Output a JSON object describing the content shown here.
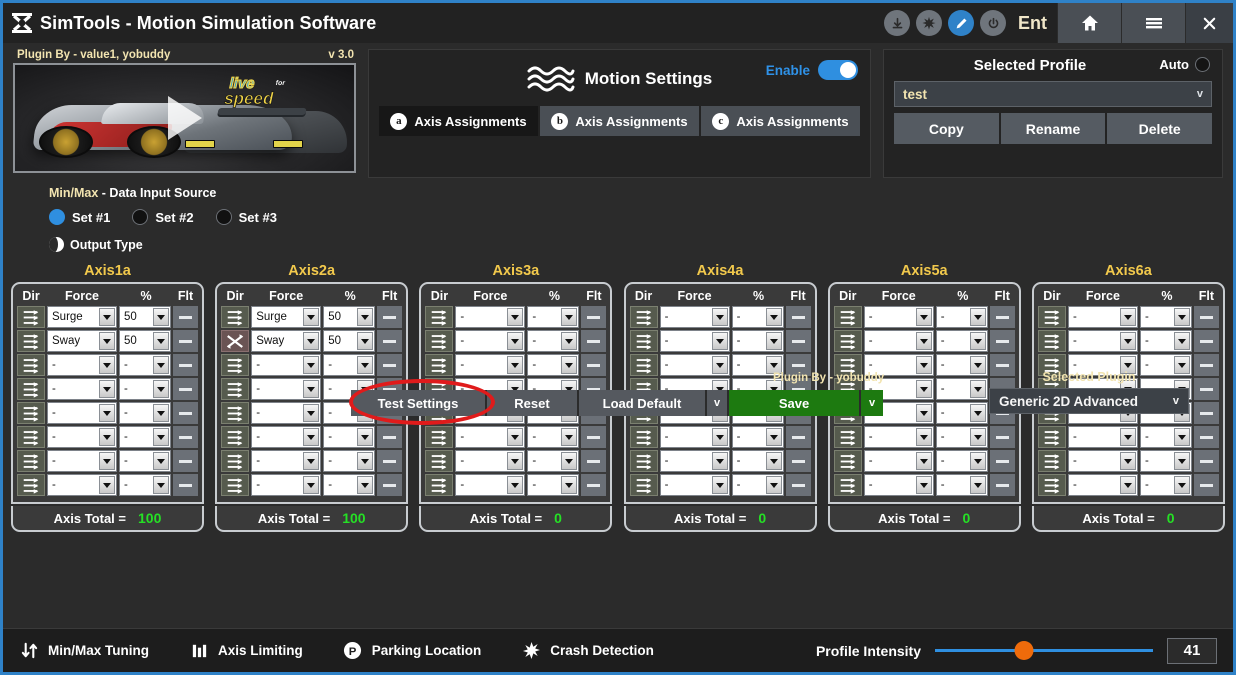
{
  "titlebar": {
    "app_name_prefix": "SimT",
    "app_name_suffix": "ls",
    "title_rest": " - Motion Simulation Software",
    "full_title": "SimTools - Motion Simulation Software",
    "icons": [
      {
        "name": "download-icon",
        "glyph": "⬇"
      },
      {
        "name": "burst-icon",
        "glyph": "✸"
      },
      {
        "name": "edit-pencil-icon",
        "glyph": "✎"
      },
      {
        "name": "power-icon",
        "glyph": "⏻"
      }
    ],
    "ent_label": "Ent",
    "home_label": "⌂",
    "menu_label": "☰",
    "close_label": "✕",
    "accent_border": "#2f82c8"
  },
  "preview": {
    "plugin_by": "Plugin By - value1, yobuddy",
    "version": "v 3.0",
    "game_logo_line1": "live",
    "game_logo_for": "for",
    "game_logo_line2": "speed"
  },
  "motion": {
    "title": "Motion Settings",
    "enable_label": "Enable",
    "enable_on": true,
    "tabs": [
      {
        "badge": "a",
        "label": "Axis Assignments",
        "active": true
      },
      {
        "badge": "b",
        "label": "Axis Assignments",
        "active": false
      },
      {
        "badge": "c",
        "label": "Axis Assignments",
        "active": false
      }
    ]
  },
  "profile": {
    "title": "Selected Profile",
    "auto_label": "Auto",
    "selected": "test",
    "chevron": "v",
    "buttons": [
      "Copy",
      "Rename",
      "Delete"
    ]
  },
  "minmax": {
    "title_hl": "Min/Max",
    "title_rest": " - Data Input Source",
    "radios": [
      {
        "label": "Set #1",
        "selected": true
      },
      {
        "label": "Set #2",
        "selected": false
      },
      {
        "label": "Set #3",
        "selected": false
      }
    ],
    "output_type": "Output Type"
  },
  "actions": {
    "test_settings": "Test Settings",
    "reset": "Reset",
    "load_default": "Load Default",
    "load_chevron": "v",
    "save": "Save",
    "save_chevron": "v",
    "plugin_by": "Plugin By - yobuddy",
    "save_color": "#1d7a10",
    "highlight_color": "#e01b1b"
  },
  "selected_plugin": {
    "title": "Selected Plugin",
    "value": "Generic 2D Advanced",
    "chevron": "v"
  },
  "axes_headers": {
    "dir": "Dir",
    "force": "Force",
    "pct": "%",
    "flt": "Flt"
  },
  "axes": [
    {
      "title": "Axis1a",
      "total_label": "Axis Total =",
      "total": "100",
      "rows": [
        {
          "dir": "forward",
          "force": "Surge",
          "pct": "50"
        },
        {
          "dir": "forward",
          "force": "Sway",
          "pct": "50"
        },
        {
          "dir": "forward",
          "force": "-",
          "pct": "-"
        },
        {
          "dir": "forward",
          "force": "-",
          "pct": "-"
        },
        {
          "dir": "forward",
          "force": "-",
          "pct": "-"
        },
        {
          "dir": "forward",
          "force": "-",
          "pct": "-"
        },
        {
          "dir": "forward",
          "force": "-",
          "pct": "-"
        },
        {
          "dir": "forward",
          "force": "-",
          "pct": "-"
        }
      ]
    },
    {
      "title": "Axis2a",
      "total_label": "Axis Total =",
      "total": "100",
      "rows": [
        {
          "dir": "forward",
          "force": "Surge",
          "pct": "50"
        },
        {
          "dir": "reverse",
          "force": "Sway",
          "pct": "50"
        },
        {
          "dir": "forward",
          "force": "-",
          "pct": "-"
        },
        {
          "dir": "forward",
          "force": "-",
          "pct": "-"
        },
        {
          "dir": "forward",
          "force": "-",
          "pct": "-"
        },
        {
          "dir": "forward",
          "force": "-",
          "pct": "-"
        },
        {
          "dir": "forward",
          "force": "-",
          "pct": "-"
        },
        {
          "dir": "forward",
          "force": "-",
          "pct": "-"
        }
      ]
    },
    {
      "title": "Axis3a",
      "total_label": "Axis Total =",
      "total": "0",
      "rows": [
        {
          "dir": "forward",
          "force": "-",
          "pct": "-"
        },
        {
          "dir": "forward",
          "force": "-",
          "pct": "-"
        },
        {
          "dir": "forward",
          "force": "-",
          "pct": "-"
        },
        {
          "dir": "forward",
          "force": "-",
          "pct": "-"
        },
        {
          "dir": "forward",
          "force": "-",
          "pct": "-"
        },
        {
          "dir": "forward",
          "force": "-",
          "pct": "-"
        },
        {
          "dir": "forward",
          "force": "-",
          "pct": "-"
        },
        {
          "dir": "forward",
          "force": "-",
          "pct": "-"
        }
      ]
    },
    {
      "title": "Axis4a",
      "total_label": "Axis Total =",
      "total": "0",
      "rows": [
        {
          "dir": "forward",
          "force": "-",
          "pct": "-"
        },
        {
          "dir": "forward",
          "force": "-",
          "pct": "-"
        },
        {
          "dir": "forward",
          "force": "-",
          "pct": "-"
        },
        {
          "dir": "forward",
          "force": "-",
          "pct": "-"
        },
        {
          "dir": "forward",
          "force": "-",
          "pct": "-"
        },
        {
          "dir": "forward",
          "force": "-",
          "pct": "-"
        },
        {
          "dir": "forward",
          "force": "-",
          "pct": "-"
        },
        {
          "dir": "forward",
          "force": "-",
          "pct": "-"
        }
      ]
    },
    {
      "title": "Axis5a",
      "total_label": "Axis Total =",
      "total": "0",
      "rows": [
        {
          "dir": "forward",
          "force": "-",
          "pct": "-"
        },
        {
          "dir": "forward",
          "force": "-",
          "pct": "-"
        },
        {
          "dir": "forward",
          "force": "-",
          "pct": "-"
        },
        {
          "dir": "forward",
          "force": "-",
          "pct": "-"
        },
        {
          "dir": "forward",
          "force": "-",
          "pct": "-"
        },
        {
          "dir": "forward",
          "force": "-",
          "pct": "-"
        },
        {
          "dir": "forward",
          "force": "-",
          "pct": "-"
        },
        {
          "dir": "forward",
          "force": "-",
          "pct": "-"
        }
      ]
    },
    {
      "title": "Axis6a",
      "total_label": "Axis Total =",
      "total": "0",
      "rows": [
        {
          "dir": "forward",
          "force": "-",
          "pct": "-"
        },
        {
          "dir": "forward",
          "force": "-",
          "pct": "-"
        },
        {
          "dir": "forward",
          "force": "-",
          "pct": "-"
        },
        {
          "dir": "forward",
          "force": "-",
          "pct": "-"
        },
        {
          "dir": "forward",
          "force": "-",
          "pct": "-"
        },
        {
          "dir": "forward",
          "force": "-",
          "pct": "-"
        },
        {
          "dir": "forward",
          "force": "-",
          "pct": "-"
        },
        {
          "dir": "forward",
          "force": "-",
          "pct": "-"
        }
      ]
    }
  ],
  "bottombar": {
    "items": [
      {
        "icon": "updown-arrows-icon",
        "label": "Min/Max Tuning"
      },
      {
        "icon": "bars-icon",
        "label": "Axis Limiting"
      },
      {
        "icon": "parking-p-icon",
        "label": "Parking Location"
      },
      {
        "icon": "burst-icon",
        "label": "Crash Detection"
      }
    ],
    "intensity_label": "Profile Intensity",
    "intensity_value": "41",
    "slider_track_color": "#2f8fe0",
    "slider_thumb_color": "#ef6b0b"
  }
}
